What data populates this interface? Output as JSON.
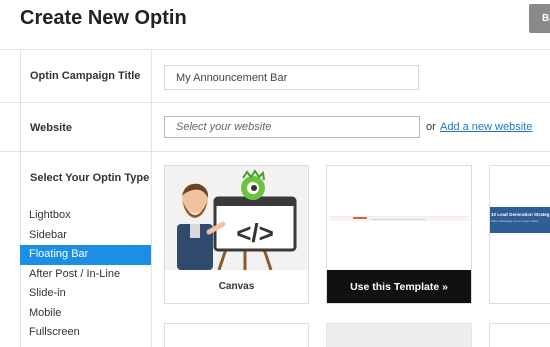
{
  "header": {
    "title": "Create New Optin",
    "back_label": "Ba"
  },
  "form": {
    "title_row": {
      "label": "Optin Campaign Title",
      "value": "My Announcement Bar"
    },
    "website_row": {
      "label": "Website",
      "placeholder": "Select your website",
      "or_text": "or",
      "add_link": "Add a new website"
    }
  },
  "optin_types": {
    "heading": "Select Your Optin Type",
    "items": [
      "Lightbox",
      "Sidebar",
      "Floating Bar",
      "After Post / In-Line",
      "Slide-in",
      "Mobile",
      "Fullscreen"
    ],
    "active": "Floating Bar"
  },
  "templates": {
    "canvas_label": "Canvas",
    "use_template_label": "Use this Template »",
    "card3_title": "10 Lead Generation Strateg",
    "card3_subtitle": "Take advantage of our expert hacks"
  },
  "colors": {
    "accent": "#1b8fe6",
    "link": "#1b78c7",
    "dark_button": "#111111",
    "back_button": "#8a8a8a",
    "blue_template": "#2f5e94"
  },
  "icons": {
    "canvas_illustration": "code-tag-easel",
    "mascot": "green-monster-icon"
  }
}
